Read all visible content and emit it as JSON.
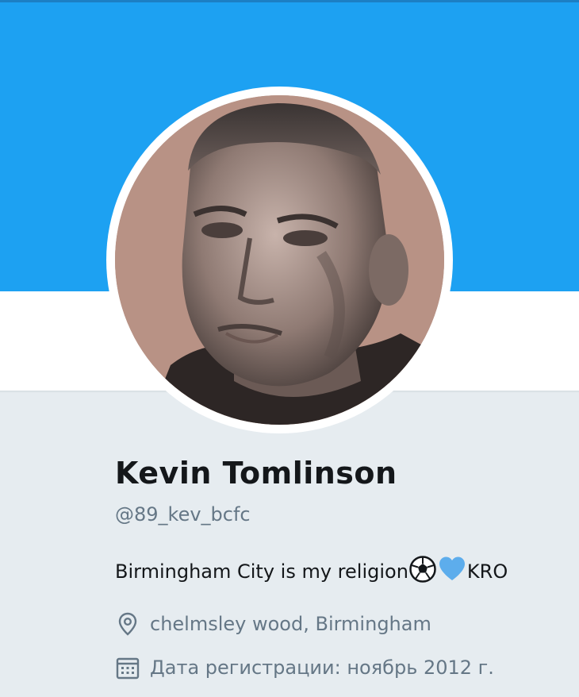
{
  "profile": {
    "name": "Kevin Tomlinson",
    "handle": "@89_kev_bcfc",
    "bio_text": "Birmingham City is my religion",
    "bio_suffix": "KRO",
    "bio_emojis": [
      "soccer-ball-emoji",
      "blue-heart-emoji"
    ],
    "location": "chelmsley wood, Birmingham",
    "joined": "Дата регистрации: ноябрь 2012 г."
  },
  "icons": {
    "location": "location-pin-icon",
    "joined": "calendar-icon"
  },
  "colors": {
    "banner": "#1da1f2",
    "page_background": "#e6ecf0",
    "name_text": "#14171a",
    "secondary_text": "#657786",
    "heart": "#5dadec"
  }
}
